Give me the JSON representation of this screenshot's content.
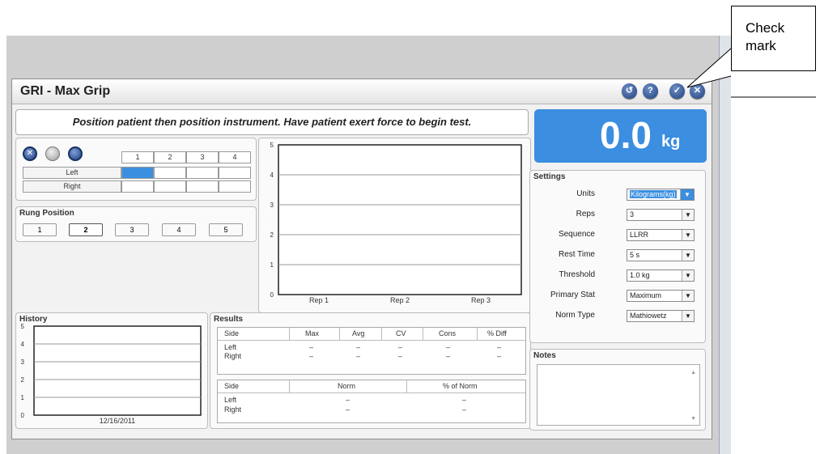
{
  "window": {
    "title": "GRI - Max Grip"
  },
  "title_buttons": [
    {
      "name": "back-icon",
      "glyph": "↺"
    },
    {
      "name": "help-icon",
      "glyph": "?"
    },
    {
      "name": "checkmark-icon",
      "glyph": "✓"
    },
    {
      "name": "close-icon",
      "glyph": "✕"
    }
  ],
  "instruction": "Position patient then position instrument. Have patient exert force to begin test.",
  "reading": {
    "value": "0.0",
    "unit": "kg"
  },
  "rep_grid": {
    "columns": [
      "1",
      "2",
      "3",
      "4"
    ],
    "rows": [
      {
        "label": "Left",
        "active_index": 0
      },
      {
        "label": "Right",
        "active_index": -1
      }
    ]
  },
  "rung_position": {
    "title": "Rung Position",
    "options": [
      "1",
      "2",
      "3",
      "4",
      "5"
    ],
    "selected": "2"
  },
  "chart_data": [
    {
      "type": "bar",
      "categories": [
        "Rep 1",
        "Rep 2",
        "Rep 3"
      ],
      "values": [
        0,
        0,
        0
      ],
      "ylim": [
        0,
        5
      ],
      "yticks": [
        "0",
        "1",
        "2",
        "3",
        "4",
        "5"
      ],
      "grid": true
    },
    {
      "type": "line",
      "title": "History",
      "x": [
        "12/16/2011"
      ],
      "values": [
        0
      ],
      "ylim": [
        0,
        5
      ],
      "yticks": [
        "0",
        "1",
        "2",
        "3",
        "4",
        "5"
      ],
      "grid": true
    }
  ],
  "results": {
    "title": "Results",
    "headers": [
      "Side",
      "Max",
      "Avg",
      "CV",
      "Cons",
      "% Diff"
    ],
    "rows": [
      [
        "Left",
        "–",
        "–",
        "–",
        "–",
        "–"
      ],
      [
        "Right",
        "–",
        "–",
        "–",
        "–",
        "–"
      ]
    ],
    "norm_headers": [
      "Side",
      "Norm",
      "% of Norm"
    ],
    "norm_rows": [
      [
        "Left",
        "–",
        "–"
      ],
      [
        "Right",
        "–",
        "–"
      ]
    ]
  },
  "settings": {
    "title": "Settings",
    "fields": [
      {
        "label": "Units",
        "value": "Kilograms(kg)",
        "highlight": true
      },
      {
        "label": "Reps",
        "value": "3"
      },
      {
        "label": "Sequence",
        "value": "LLRR"
      },
      {
        "label": "Rest Time",
        "value": "5 s"
      },
      {
        "label": "Threshold",
        "value": "1.0 kg"
      },
      {
        "label": "Primary Stat",
        "value": "Maximum"
      },
      {
        "label": "Norm Type",
        "value": "Mathiowetz"
      }
    ]
  },
  "notes": {
    "title": "Notes"
  },
  "callout": "Check\nmark",
  "colors": {
    "accent": "#3b8ee0",
    "button": "#1e3f7f"
  }
}
